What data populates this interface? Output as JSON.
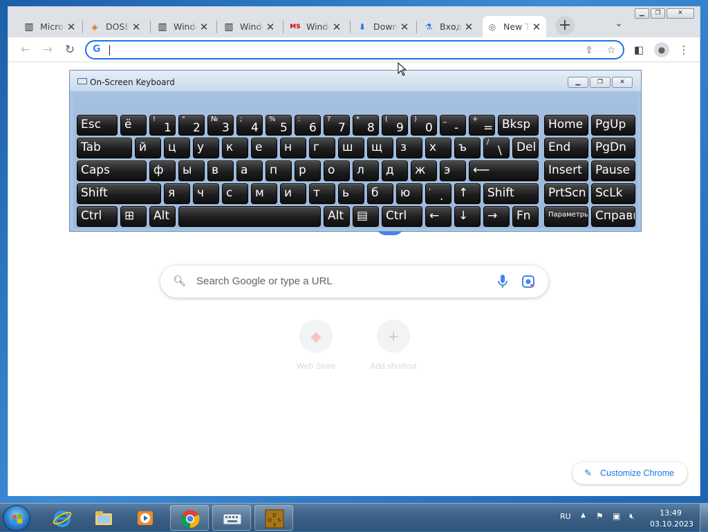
{
  "browser": {
    "tabs": [
      {
        "label": "Microsoft",
        "icon": "museum-icon",
        "active": false
      },
      {
        "label": "DOSBox",
        "icon": "diamond-icon",
        "active": false
      },
      {
        "label": "Windows",
        "icon": "museum-icon",
        "active": false
      },
      {
        "label": "Windows",
        "icon": "museum-icon",
        "active": false
      },
      {
        "label": "Windows",
        "icon": "ms-logo-icon",
        "active": false
      },
      {
        "label": "Download",
        "icon": "download-icon",
        "active": false
      },
      {
        "label": "Вход",
        "icon": "flask-icon",
        "active": false
      },
      {
        "label": "New Tab",
        "icon": "chrome-icon",
        "active": true
      }
    ],
    "new_tab_button": "+",
    "omnibox": {
      "value": "",
      "g_label": "G"
    }
  },
  "ntp": {
    "search_placeholder": "Search Google or type a URL",
    "shortcuts": [
      {
        "label": "Web Store",
        "icon": "webstore-icon"
      },
      {
        "label": "Add shortcut",
        "icon": "plus-icon"
      }
    ],
    "customize_label": "Customize Chrome"
  },
  "osk": {
    "title": "On-Screen Keyboard",
    "rows": [
      [
        {
          "main": "Esc"
        },
        {
          "main": "ё"
        },
        {
          "shift": "!",
          "main": "1"
        },
        {
          "shift": "\"",
          "main": "2"
        },
        {
          "shift": "№",
          "main": "3"
        },
        {
          "shift": ";",
          "main": "4"
        },
        {
          "shift": "%",
          "main": "5"
        },
        {
          "shift": ":",
          "main": "6"
        },
        {
          "shift": "?",
          "main": "7"
        },
        {
          "shift": "*",
          "main": "8"
        },
        {
          "shift": "(",
          "main": "9"
        },
        {
          "shift": ")",
          "main": "0"
        },
        {
          "shift": "_",
          "main": "-"
        },
        {
          "shift": "+",
          "main": "="
        },
        {
          "main": "Bksp"
        },
        {
          "main": "Home"
        },
        {
          "main": "PgUp"
        }
      ],
      [
        {
          "main": "Tab"
        },
        {
          "main": "й"
        },
        {
          "main": "ц"
        },
        {
          "main": "у"
        },
        {
          "main": "к"
        },
        {
          "main": "е"
        },
        {
          "main": "н"
        },
        {
          "main": "г"
        },
        {
          "main": "ш"
        },
        {
          "main": "щ"
        },
        {
          "main": "з"
        },
        {
          "main": "х"
        },
        {
          "main": "ъ"
        },
        {
          "shift": "/",
          "main": "\\"
        },
        {
          "main": "Del"
        },
        {
          "main": "End"
        },
        {
          "main": "PgDn"
        }
      ],
      [
        {
          "main": "Caps"
        },
        {
          "main": "ф"
        },
        {
          "main": "ы"
        },
        {
          "main": "в"
        },
        {
          "main": "а"
        },
        {
          "main": "п"
        },
        {
          "main": "р"
        },
        {
          "main": "о"
        },
        {
          "main": "л"
        },
        {
          "main": "д"
        },
        {
          "main": "ж"
        },
        {
          "main": "э"
        },
        {
          "main": "⟵"
        },
        {
          "main": "Insert"
        },
        {
          "main": "Pause"
        }
      ],
      [
        {
          "main": "Shift"
        },
        {
          "main": "я"
        },
        {
          "main": "ч"
        },
        {
          "main": "с"
        },
        {
          "main": "м"
        },
        {
          "main": "и"
        },
        {
          "main": "т"
        },
        {
          "main": "ь"
        },
        {
          "main": "б"
        },
        {
          "main": "ю"
        },
        {
          "shift": ",",
          "main": "."
        },
        {
          "main": "↑"
        },
        {
          "main": "Shift"
        },
        {
          "main": "PrtScn"
        },
        {
          "main": "ScLk"
        }
      ],
      [
        {
          "main": "Ctrl"
        },
        {
          "main": "⊞"
        },
        {
          "main": "Alt"
        },
        {
          "main": ""
        },
        {
          "main": "Alt"
        },
        {
          "main": "▤"
        },
        {
          "main": "Ctrl"
        },
        {
          "main": "←"
        },
        {
          "main": "↓"
        },
        {
          "main": "→"
        },
        {
          "main": "Fn"
        },
        {
          "main": "Параметры"
        },
        {
          "main": "Справка"
        }
      ]
    ]
  },
  "taskbar": {
    "apps": [
      {
        "name": "ie-icon",
        "pinned": false
      },
      {
        "name": "explorer-icon",
        "pinned": false
      },
      {
        "name": "media-player-icon",
        "pinned": false
      },
      {
        "name": "chrome-icon",
        "pinned": true
      },
      {
        "name": "osk-icon",
        "pinned": true
      },
      {
        "name": "dosbox-icon",
        "pinned": true
      }
    ],
    "language": "RU",
    "time": "13:49",
    "date": "03.10.2023"
  },
  "colors": {
    "accent": "#1a73e8",
    "tab_strip": "#dee1e6",
    "key_face": "#1d1d1d",
    "osk_bg": "#a9c5e5"
  }
}
